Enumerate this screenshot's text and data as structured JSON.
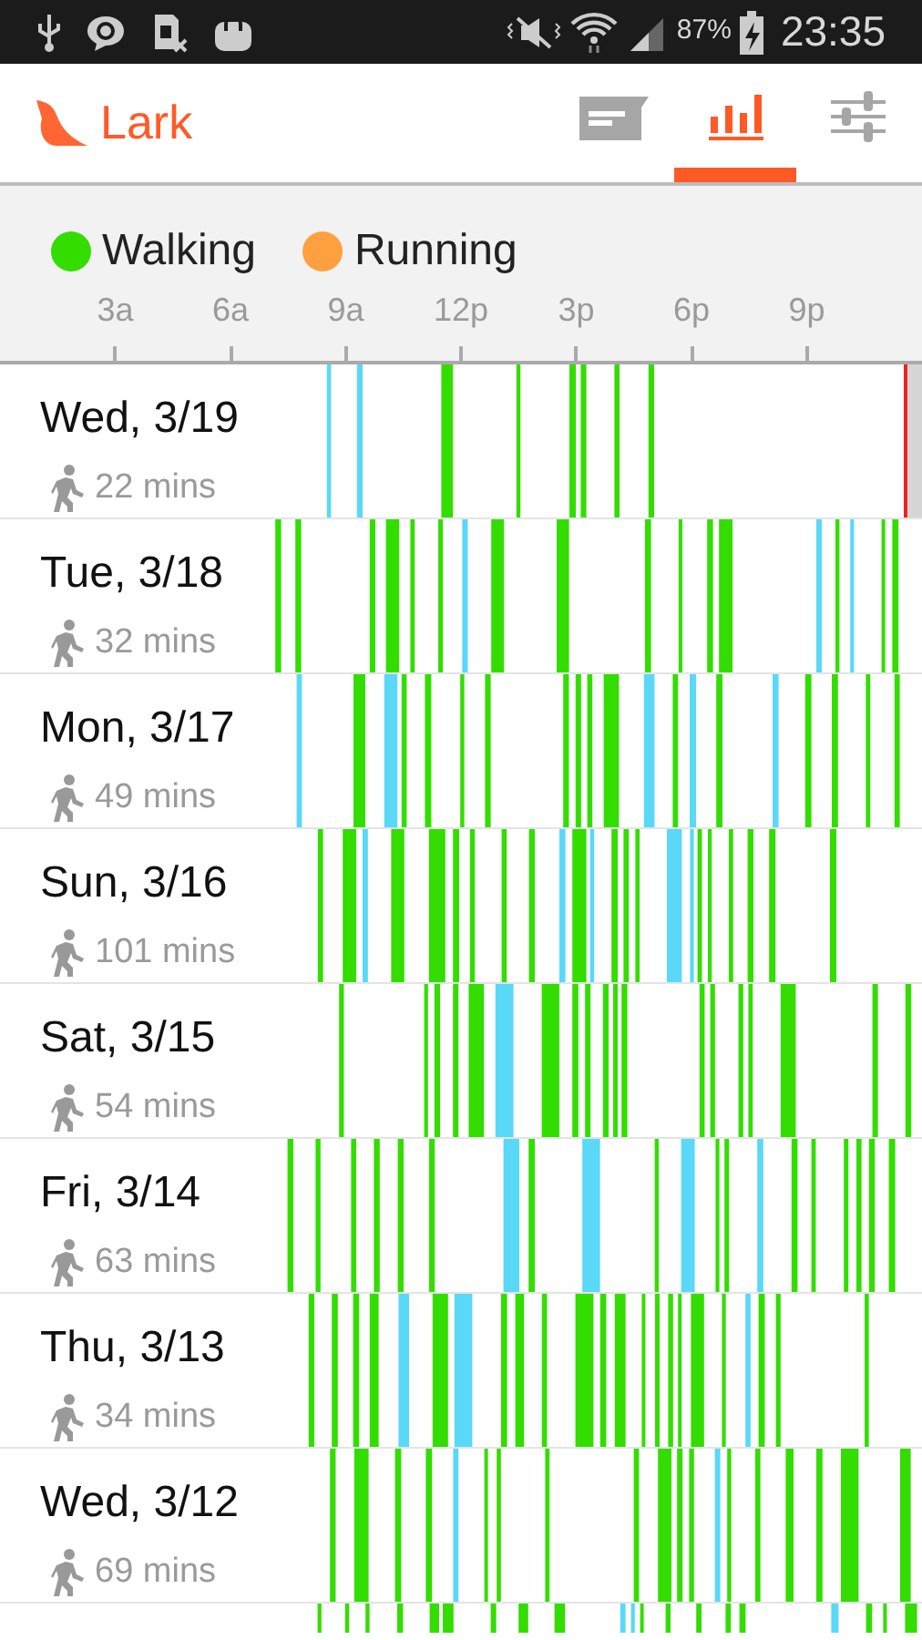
{
  "status_bar": {
    "battery": "87%",
    "time": "23:35"
  },
  "app": {
    "title": "Lark"
  },
  "tabs": [
    {
      "kind": "feed",
      "selected": false
    },
    {
      "kind": "stats",
      "selected": true
    },
    {
      "kind": "settings",
      "selected": false
    }
  ],
  "legend": [
    {
      "label": "Walking",
      "color": "#33dd00"
    },
    {
      "label": "Running",
      "color": "#ffa040"
    }
  ],
  "time_axis": [
    "3a",
    "6a",
    "9a",
    "12p",
    "3p",
    "6p",
    "9p"
  ],
  "days": [
    {
      "date": "Wed, 3/19",
      "duration": "22 mins",
      "today": true
    },
    {
      "date": "Tue, 3/18",
      "duration": "32 mins",
      "today": false
    },
    {
      "date": "Mon, 3/17",
      "duration": "49 mins",
      "today": false
    },
    {
      "date": "Sun, 3/16",
      "duration": "101 mins",
      "today": false
    },
    {
      "date": "Sat, 3/15",
      "duration": "54 mins",
      "today": false
    },
    {
      "date": "Fri, 3/14",
      "duration": "63 mins",
      "today": false
    },
    {
      "date": "Thu, 3/13",
      "duration": "34 mins",
      "today": false
    },
    {
      "date": "Wed, 3/12",
      "duration": "69 mins",
      "today": false
    }
  ]
}
